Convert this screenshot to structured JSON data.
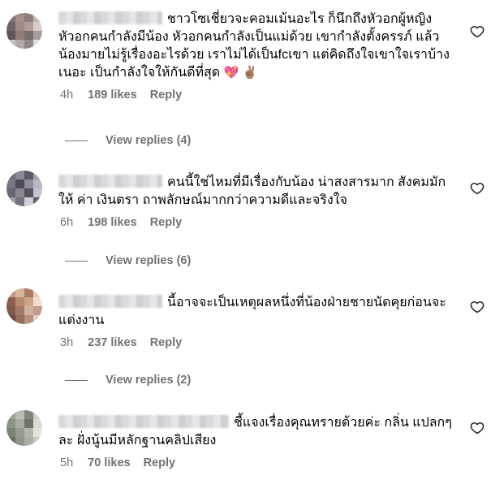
{
  "comments": [
    {
      "text_line1": "ชาวโซเชี่ยวจะคอมเม้นอะไร ก็นึกถึงหัวอกผู้หญิง",
      "text_rest": "หัวอกคนกำลังมีน้อง หัวอกคนกำลังเป็นแม่ด้วย เขากำลังตั้งครรภ์ แล้วน้องมายไม่รู้เรื่องอะไรด้วย เราไม่ได้เป็นfcเขา แต่คิดถึงใจเขาใจเราบ้างเนอะ เป็นกำลังใจให้กันดีที่สุด",
      "emoji": "💖 ✌🏽",
      "time": "4h",
      "likes": "189 likes",
      "reply": "Reply",
      "view_replies": "View replies (4)",
      "avatar_colors": [
        "#7d7577",
        "#a58d88",
        "#8b7e7e",
        "#c3b5b3",
        "#6c6465",
        "#9f8a85",
        "#b59e98",
        "#d7cecc",
        "#5e5556",
        "#8f7c79",
        "#7a6c6c",
        "#a69c9c",
        "#c8c1c2",
        "#b2a8a8",
        "#918788",
        "#e3dfe0"
      ]
    },
    {
      "text_line1": "คนนี้ใช่ไหมที่มีเรื่องกับน้อง น่าสงสารมาก สังคมมักให้",
      "text_rest": "ค่า เงินตรา ถาพลักษณ์มากกว่าความดีและจริงใจ",
      "emoji": "",
      "time": "6h",
      "likes": "198 likes",
      "reply": "Reply",
      "view_replies": "View replies (6)",
      "avatar_colors": [
        "#6e6a78",
        "#8c8796",
        "#5b5766",
        "#a39fae",
        "#7a7585",
        "#4f4a5a",
        "#928d9c",
        "#b8b4c2",
        "#69646f",
        "#8a8592",
        "#56515d",
        "#c5c1cc",
        "#a09ba8",
        "#76717f",
        "#d2cfd7",
        "#615c68"
      ]
    },
    {
      "text_line1": "นี้อาจจะเป็นเหตุผลหนึ่งที่น้องฝ่ายชายนัดคุยก่อนจะ",
      "text_rest": "แต่งงาน",
      "emoji": "",
      "time": "3h",
      "likes": "237 likes",
      "reply": "Reply",
      "view_replies": "View replies (2)",
      "avatar_colors": [
        "#c49a80",
        "#d8b49b",
        "#a97c66",
        "#e5cbb8",
        "#8a5e4c",
        "#b98a72",
        "#cfa388",
        "#f0ddd0",
        "#7e5a4b",
        "#a47a67",
        "#d3b09c",
        "#c29c88",
        "#6f4c3f",
        "#957062",
        "#b8907c",
        "#e4cfc3"
      ]
    },
    {
      "text_line1": "ชี้แจงเรื่องคุณทรายด้วยค่ะ กลิ่น",
      "text_rest": "แปลกๆละ ฝั่งนู้นมีหลักฐานคลิปเสียง",
      "emoji": "",
      "time": "5h",
      "likes": "70 likes",
      "reply": "Reply",
      "view_replies": "",
      "avatar_colors": [
        "#9ea59c",
        "#b7bdb3",
        "#7f867d",
        "#c9cec6",
        "#8b9288",
        "#a6ad9f",
        "#6e756c",
        "#d8dcd5",
        "#7c8379",
        "#959c93",
        "#b0b6ad",
        "#e2e5df",
        "#6a7167",
        "#8e9589",
        "#a9afa5",
        "#c3c8c0"
      ]
    }
  ],
  "icons": {
    "like": "heart-outline-icon"
  }
}
